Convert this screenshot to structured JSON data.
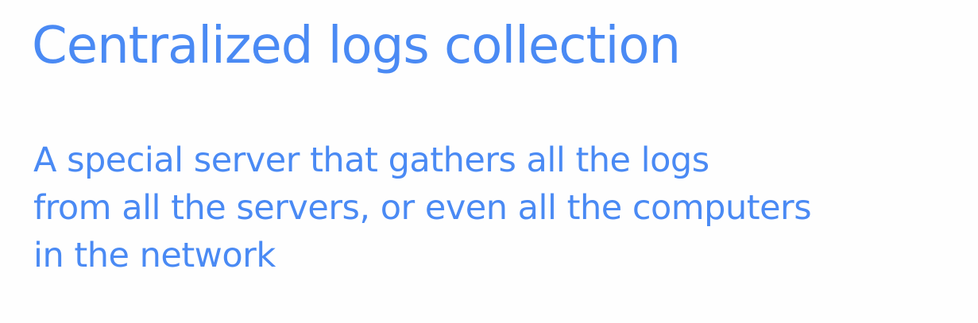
{
  "slide": {
    "title": "Centralized logs collection",
    "body_lines": [
      "A special server that gathers all the logs",
      "from all the servers, or even all the computers",
      "in the network"
    ],
    "text_color": "#4a8af4",
    "background_color": "#fefefe"
  }
}
